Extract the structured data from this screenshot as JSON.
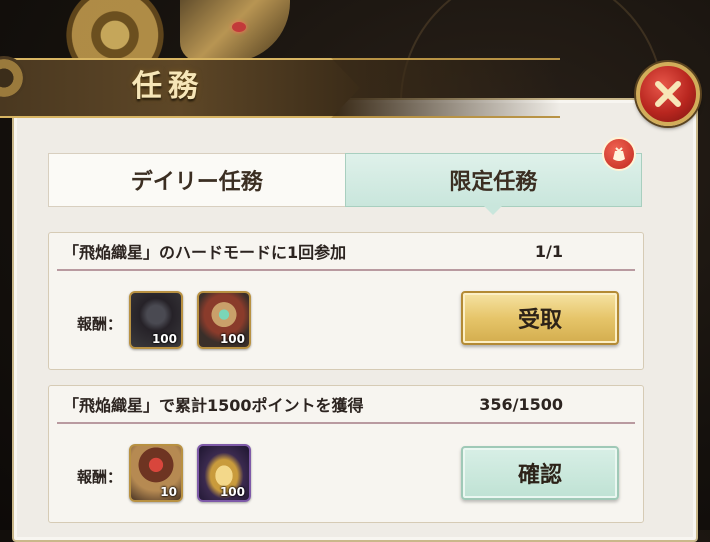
{
  "header": {
    "title": "任務"
  },
  "tabs": [
    {
      "label": "デイリー任務",
      "active": false
    },
    {
      "label": "限定任務",
      "active": true
    }
  ],
  "missions": [
    {
      "title": "「飛焔織星」のハードモードに1回参加",
      "progress": "1/1",
      "reward_label": "報酬：",
      "rewards": [
        {
          "icon": "dark-crystal-icon",
          "qty": "100"
        },
        {
          "icon": "jade-pendant-icon",
          "qty": "100"
        }
      ],
      "button_label": "受取"
    },
    {
      "title": "「飛焔織星」で累計1500ポイントを獲得",
      "progress": "356/1500",
      "reward_label": "報酬：",
      "rewards": [
        {
          "icon": "treasure-box-icon",
          "qty": "10"
        },
        {
          "icon": "gold-ingot-icon",
          "qty": "100"
        }
      ],
      "button_label": "確認"
    }
  ],
  "colors": {
    "claim_button": "#e6c56a",
    "confirm_button": "#bfe2d4",
    "close_button": "#b8261f",
    "active_tab": "#c9e6dc"
  }
}
